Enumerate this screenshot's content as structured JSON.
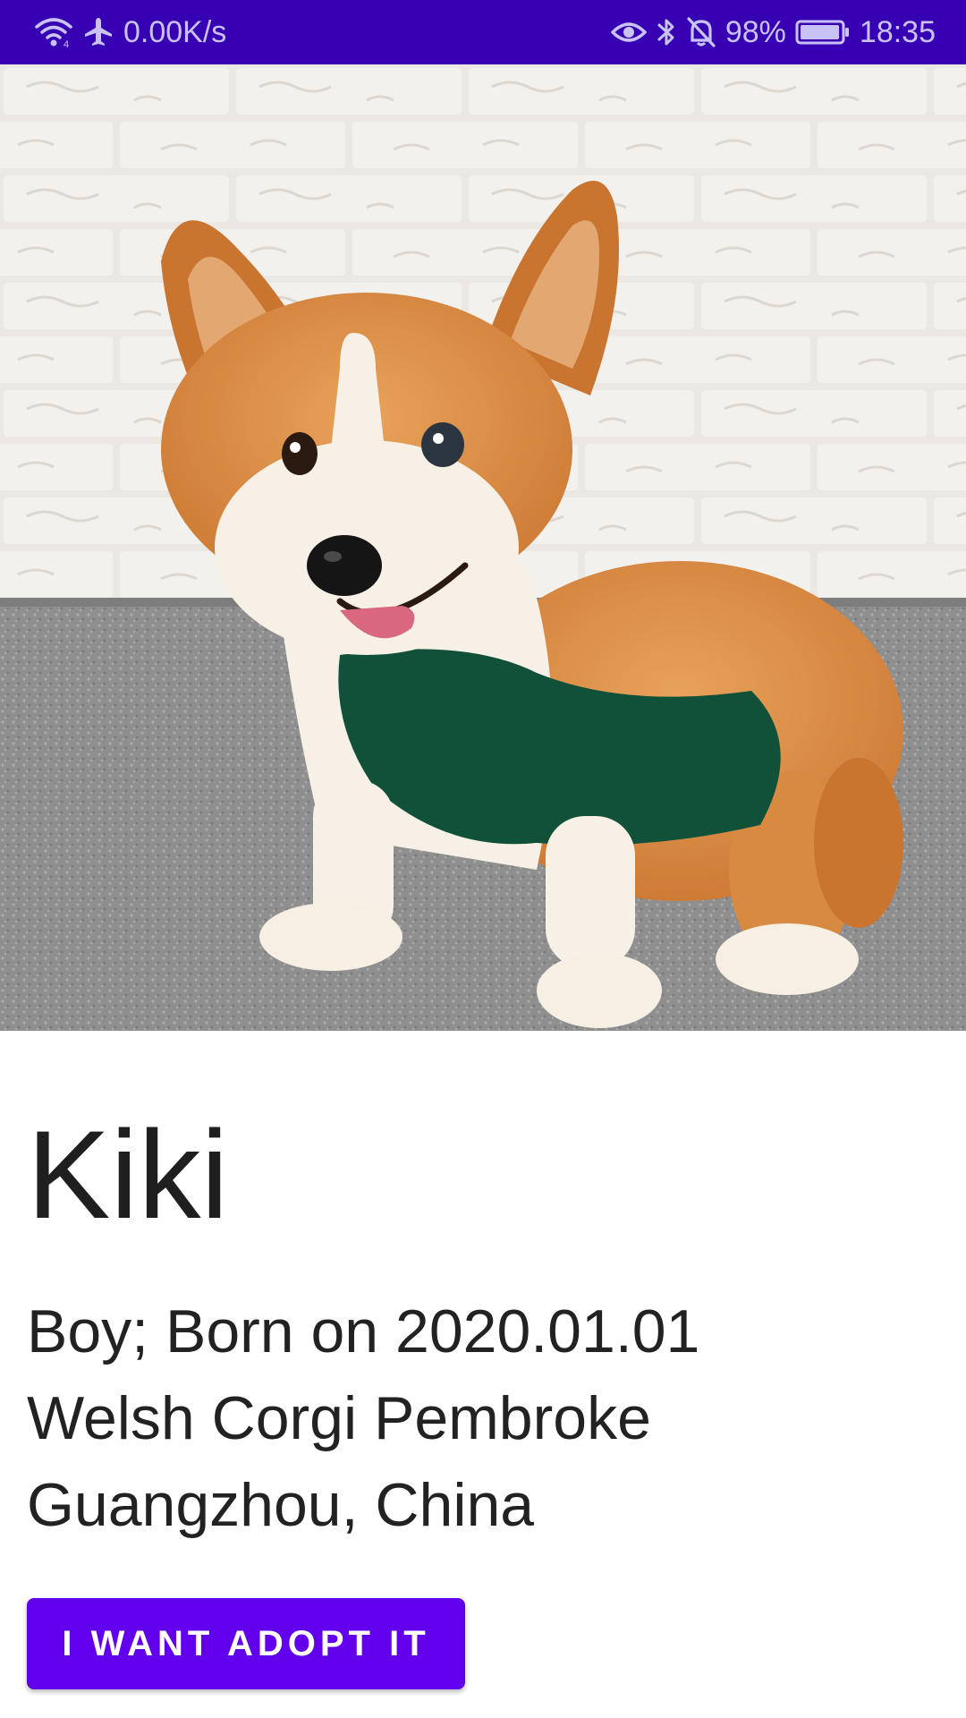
{
  "colors": {
    "status_bar": "#3700b3",
    "accent": "#6200ee",
    "status_text": "#c9c2f5"
  },
  "status_bar": {
    "net_speed": "0.00K/s",
    "battery_percent": "98%",
    "battery_level": 0.98,
    "time": "18:35",
    "icons_left": [
      "wifi-icon",
      "airplane-mode-icon"
    ],
    "icons_right": [
      "eye-comfort-icon",
      "bluetooth-icon",
      "bell-muted-icon",
      "battery-icon"
    ]
  },
  "pet": {
    "name": "Kiki",
    "info": [
      "Boy; Born on 2020.01.01",
      "Welsh Corgi Pembroke",
      "Guangzhou, China"
    ]
  },
  "actions": {
    "adopt_label": "I WANT ADOPT IT"
  }
}
